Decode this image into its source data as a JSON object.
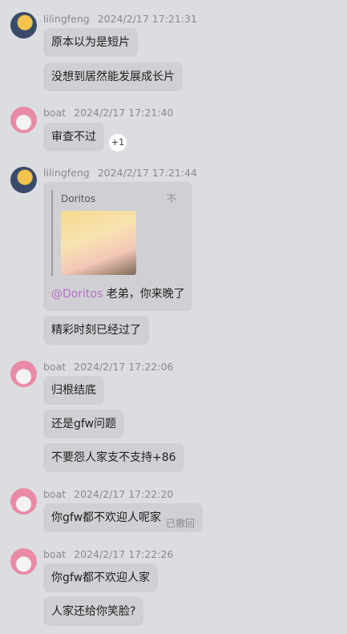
{
  "messages": {
    "m1": {
      "name": "lilingfeng",
      "time": "2024/2/17 17:21:31",
      "lines": [
        "原本以为是短片",
        "没想到居然能发展成长片"
      ]
    },
    "m2": {
      "name": "boat",
      "time": "2024/2/17 17:21:40",
      "lines": [
        "审查不过"
      ],
      "reaction": "+1"
    },
    "m3": {
      "name": "lilingfeng",
      "time": "2024/2/17 17:21:44",
      "quote": {
        "name": "Doritos",
        "icon": "不"
      },
      "mention": "@Doritos",
      "text": " 老弟，你来晚了",
      "lines": [
        "精彩时刻已经过了"
      ]
    },
    "m4": {
      "name": "boat",
      "time": "2024/2/17 17:22:06",
      "lines": [
        "归根结底",
        "还是gfw问题",
        "不要怨人家支不支持+86"
      ]
    },
    "m5": {
      "name": "boat",
      "time": "2024/2/17 17:22:20",
      "lines": [
        "你gfw都不欢迎人呢家"
      ],
      "status": "已撤回"
    },
    "m6": {
      "name": "boat",
      "time": "2024/2/17 17:22:26",
      "lines": [
        "你gfw都不欢迎人家",
        "人家还给你笑脸?"
      ]
    }
  }
}
